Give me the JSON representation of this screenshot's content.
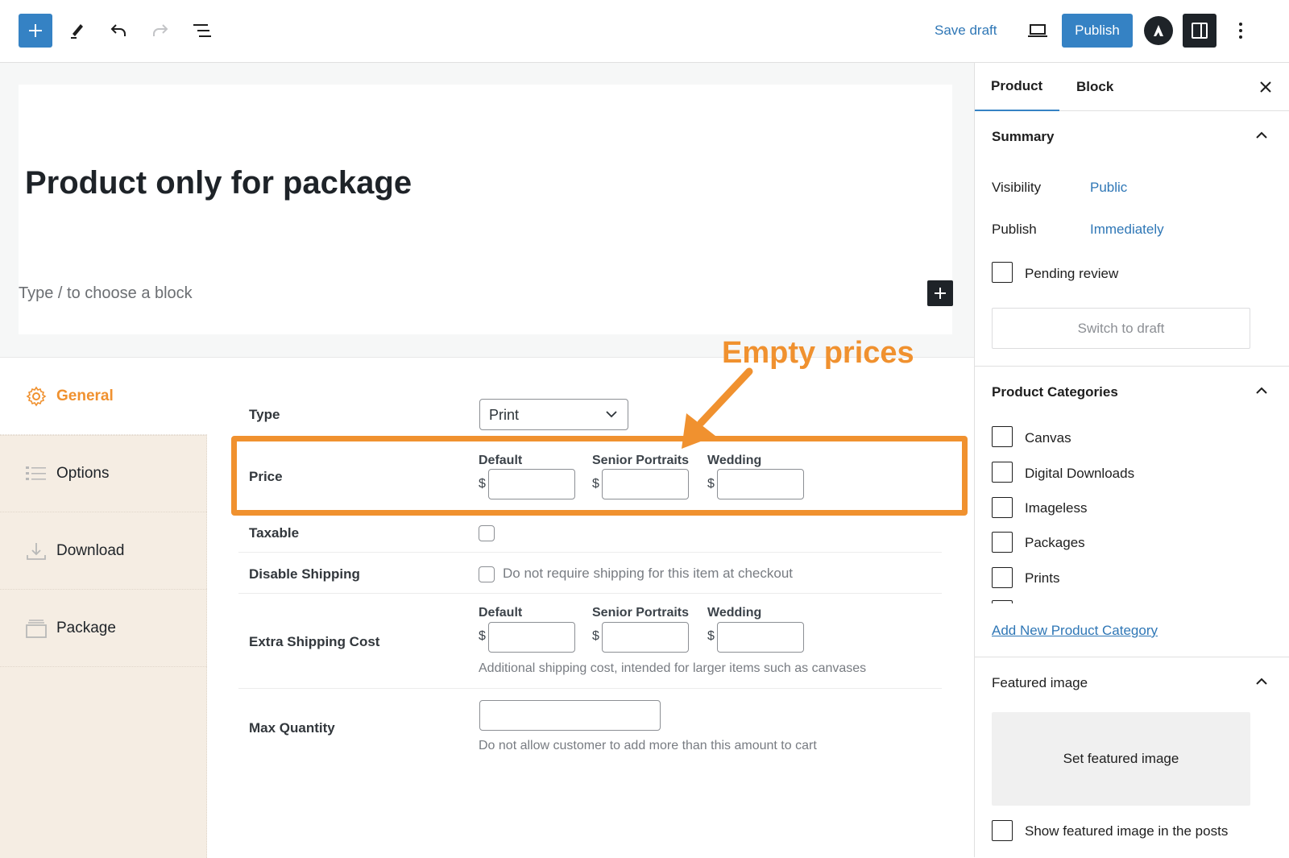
{
  "toolbar": {
    "add_block_icon": "plus-icon",
    "tools_icon": "pencil-icon",
    "undo_icon": "undo-icon",
    "redo_icon": "redo-icon",
    "list_view_icon": "list-view-icon",
    "save_draft_label": "Save draft",
    "preview_icon": "laptop-icon",
    "publish_label": "Publish",
    "plugin_logo_icon": "logo-icon",
    "settings_icon": "sidebar-toggle-icon",
    "more_icon": "more-vertical-icon",
    "accent_color": "#3582c4"
  },
  "editor": {
    "post_title": "Product only for package",
    "block_placeholder": "Type / to choose a block"
  },
  "product_meta": {
    "tabs": [
      {
        "label": "General",
        "icon": "gear-icon",
        "active": true
      },
      {
        "label": "Options",
        "icon": "list-icon",
        "active": false
      },
      {
        "label": "Download",
        "icon": "download-icon",
        "active": false
      },
      {
        "label": "Package",
        "icon": "package-icon",
        "active": false
      }
    ],
    "type": {
      "label": "Type",
      "value": "Print"
    },
    "price": {
      "label": "Price",
      "currency": "$",
      "columns": [
        {
          "label": "Default",
          "value": ""
        },
        {
          "label": "Senior Portraits",
          "value": ""
        },
        {
          "label": "Wedding",
          "value": ""
        }
      ]
    },
    "taxable": {
      "label": "Taxable",
      "checked": false
    },
    "disable_shipping": {
      "label": "Disable Shipping",
      "checked": false,
      "help": "Do not require shipping for this item at checkout"
    },
    "extra_shipping": {
      "label": "Extra Shipping Cost",
      "currency": "$",
      "columns": [
        {
          "label": "Default",
          "value": ""
        },
        {
          "label": "Senior Portraits",
          "value": ""
        },
        {
          "label": "Wedding",
          "value": ""
        }
      ],
      "help": "Additional shipping cost, intended for larger items such as canvases"
    },
    "max_quantity": {
      "label": "Max Quantity",
      "value": "",
      "help": "Do not allow customer to add more than this amount to cart"
    }
  },
  "annotation": {
    "text": "Empty prices",
    "color": "#f0912f"
  },
  "sidebar": {
    "tabs": [
      {
        "label": "Product",
        "active": true
      },
      {
        "label": "Block",
        "active": false
      }
    ],
    "close_icon": "close-icon",
    "summary": {
      "title": "Summary",
      "visibility_label": "Visibility",
      "visibility_value": "Public",
      "publish_label": "Publish",
      "publish_value": "Immediately",
      "pending_review_label": "Pending review",
      "pending_review_checked": false,
      "switch_to_draft_label": "Switch to draft"
    },
    "categories": {
      "title": "Product Categories",
      "items": [
        {
          "label": "Canvas",
          "checked": false
        },
        {
          "label": "Digital Downloads",
          "checked": false
        },
        {
          "label": "Imageless",
          "checked": false
        },
        {
          "label": "Packages",
          "checked": false
        },
        {
          "label": "Prints",
          "checked": false
        }
      ],
      "add_new_label": "Add New Product Category"
    },
    "featured_image": {
      "title": "Featured image",
      "set_label": "Set featured image",
      "show_in_posts_label": "Show featured image in the posts",
      "show_in_posts_checked": false
    }
  }
}
